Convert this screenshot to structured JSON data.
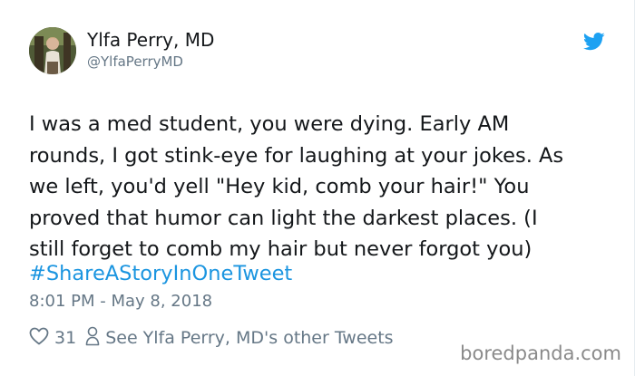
{
  "author": {
    "name": "Ylfa Perry, MD",
    "handle": "@YlfaPerryMD"
  },
  "icons": {
    "avatar": "avatar-photo",
    "brand": "twitter-bird-icon",
    "like": "heart-icon",
    "profile": "person-icon"
  },
  "tweet": {
    "text": "I was a med student, you were dying. Early AM\nrounds, I got stink-eye for laughing at your jokes. As\nwe left, you'd yell \"Hey kid, comb your hair!\" You\nproved that humor can light the darkest places. (I\nstill forget to comb my hair but never forgot you)",
    "hashtag": "#ShareAStoryInOneTweet",
    "timestamp": "8:01 PM - May 8, 2018"
  },
  "actions": {
    "like_count": "31",
    "other_tweets_label": "See Ylfa Perry, MD's other Tweets"
  },
  "watermark": "boredpanda.com",
  "colors": {
    "link": "#1b95e0",
    "twitter_blue": "#1da1f2",
    "secondary_text": "#657786",
    "primary_text": "#14171a"
  }
}
